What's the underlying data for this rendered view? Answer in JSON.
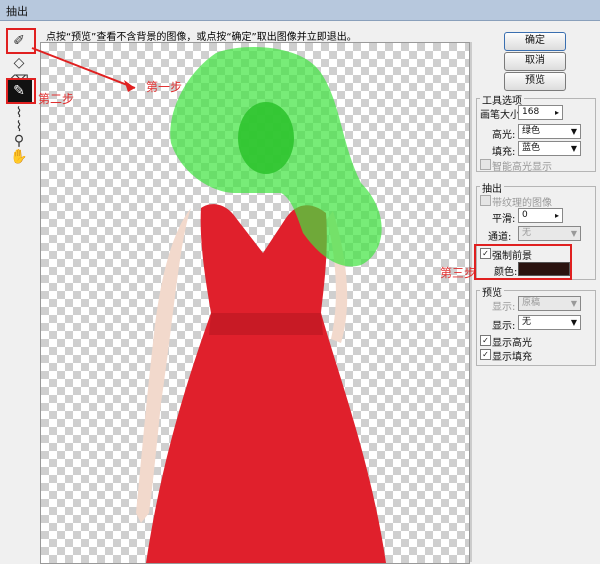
{
  "window": {
    "title": "抽出"
  },
  "instruction": "点按“预览”查看不含背景的图像，或点按“确定”取出图像并立即退出。",
  "annotations": {
    "step1": "第一步",
    "step2": "第二步",
    "step3": "第三步"
  },
  "buttons": {
    "ok": "确定",
    "cancel": "取消",
    "preview": "预览"
  },
  "tool_options": {
    "label": "工具选项",
    "brush_size_label": "画笔大小:",
    "brush_size_value": "168",
    "highlight_label": "高光:",
    "highlight_value": "绿色",
    "fill_label": "填充:",
    "fill_value": "蓝色",
    "smart_highlight": "智能高光显示"
  },
  "extract": {
    "label": "抽出",
    "textured_image": "带纹理的图像",
    "smooth_label": "平滑:",
    "smooth_value": "0",
    "channel_label": "通道:",
    "channel_value": "无",
    "force_foreground": "强制前景",
    "color_label": "颜色:",
    "color_hex": "#2a130f"
  },
  "preview": {
    "label": "预览",
    "show1_label": "显示:",
    "show1_value": "原稿",
    "show2_label": "显示:",
    "show2_value": "无",
    "show_highlight": "显示高光",
    "show_fill": "显示填充"
  },
  "colors": {
    "highlight": "#3ee43e",
    "dress": "#e0202c",
    "annotation": "#e02020"
  }
}
